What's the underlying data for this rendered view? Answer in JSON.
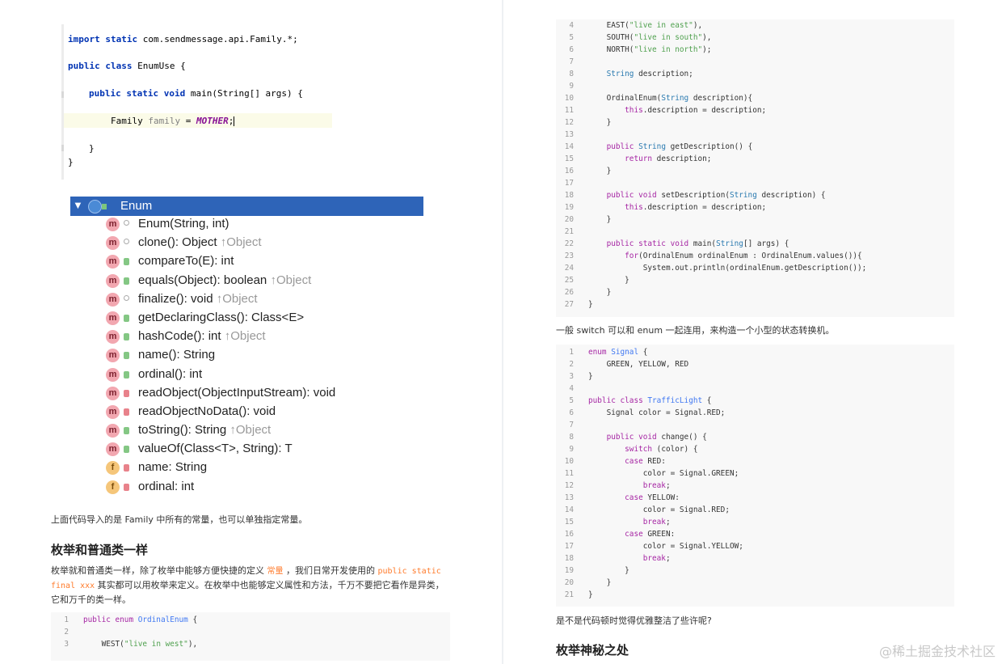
{
  "ide": {
    "lines": [
      {
        "segments": [
          [
            "kw",
            "import static "
          ],
          [
            "plain",
            "com.sendmessage.api.Family.*;"
          ]
        ]
      },
      {
        "segments": [
          [
            "kw",
            "public class "
          ],
          [
            "plain",
            "EnumUse {"
          ]
        ]
      },
      {
        "segments": [
          [
            "kw",
            "public static void "
          ],
          [
            "plain",
            "main(String[] args) {"
          ]
        ]
      },
      {
        "segments": [
          [
            "plain",
            "Family "
          ],
          [
            "grey",
            "family"
          ],
          [
            "plain",
            " = "
          ],
          [
            "const",
            "MOTHER"
          ],
          [
            "plain",
            ";"
          ]
        ]
      },
      {
        "segments": [
          [
            "plain",
            "}"
          ]
        ]
      },
      {
        "segments": [
          [
            "plain",
            "}"
          ]
        ]
      }
    ]
  },
  "tree": {
    "root": "Enum",
    "members": [
      {
        "kind": "m",
        "access": "key",
        "sig": "Enum(String, int)",
        "inherited": ""
      },
      {
        "kind": "m",
        "access": "key",
        "sig": "clone(): Object",
        "inherited": "↑Object"
      },
      {
        "kind": "m",
        "access": "pub",
        "sig": "compareTo(E): int",
        "inherited": ""
      },
      {
        "kind": "m",
        "access": "pub",
        "sig": "equals(Object): boolean",
        "inherited": "↑Object"
      },
      {
        "kind": "m",
        "access": "key",
        "sig": "finalize(): void",
        "inherited": "↑Object"
      },
      {
        "kind": "m",
        "access": "pub",
        "sig": "getDeclaringClass(): Class<E>",
        "inherited": ""
      },
      {
        "kind": "m",
        "access": "pub",
        "sig": "hashCode(): int",
        "inherited": "↑Object"
      },
      {
        "kind": "m",
        "access": "pub",
        "sig": "name(): String",
        "inherited": ""
      },
      {
        "kind": "m",
        "access": "pub",
        "sig": "ordinal(): int",
        "inherited": ""
      },
      {
        "kind": "m",
        "access": "priv",
        "sig": "readObject(ObjectInputStream): void",
        "inherited": ""
      },
      {
        "kind": "m",
        "access": "priv",
        "sig": "readObjectNoData(): void",
        "inherited": ""
      },
      {
        "kind": "m",
        "access": "pub",
        "sig": "toString(): String",
        "inherited": "↑Object"
      },
      {
        "kind": "m",
        "access": "pub",
        "sig": "valueOf(Class<T>, String): T",
        "inherited": ""
      },
      {
        "kind": "f",
        "access": "priv",
        "sig": "name: String",
        "inherited": ""
      },
      {
        "kind": "f",
        "access": "priv",
        "sig": "ordinal: int",
        "inherited": ""
      }
    ]
  },
  "text": {
    "p1": "上面代码导入的是 Family 中所有的常量，也可以单独指定常量。",
    "h_enum_like_class": "枚举和普通类一样",
    "p2_a": "枚举就和普通类一样，除了枚举中能够方便快捷的定义 ",
    "p2_code1": "常量",
    "p2_b": " ，我们日常开发使用的 ",
    "p2_code2": "public static",
    "p2_code3": "final xxx",
    "p2_c": " 其实都可以用枚举来定义。在枚举中也能够定义属性和方法，千万不要把它看作是异类，",
    "p2_d": "它和万千的类一样。",
    "p3": "一般 switch 可以和 enum 一起连用，来构造一个小型的状态转换机。",
    "p4": "是不是代码顿时觉得优雅整洁了些许呢?",
    "h_secret": "枚举神秘之处",
    "watermark": "@稀土掘金技术社区"
  },
  "code_left": [
    [
      "1",
      "<k>public enum </k><t>OrdinalEnum</t> {"
    ],
    [
      "2",
      ""
    ],
    [
      "3",
      "    WEST(<s>\"live in west\"</s>),"
    ]
  ],
  "code_right_top": [
    [
      "4",
      "    EAST(<s>\"live in east\"</s>),"
    ],
    [
      "5",
      "    SOUTH(<s>\"live in south\"</s>),"
    ],
    [
      "6",
      "    NORTH(<s>\"live in north\"</s>);"
    ],
    [
      "7",
      ""
    ],
    [
      "8",
      "    <b>String</b> description;"
    ],
    [
      "9",
      ""
    ],
    [
      "10",
      "    OrdinalEnum(<b>String</b> description){"
    ],
    [
      "11",
      "        <k>this</k>.description = description;"
    ],
    [
      "12",
      "    }"
    ],
    [
      "13",
      ""
    ],
    [
      "14",
      "    <k>public</k> <b>String</b> getDescription() {"
    ],
    [
      "15",
      "        <k>return</k> description;"
    ],
    [
      "16",
      "    }"
    ],
    [
      "17",
      ""
    ],
    [
      "18",
      "    <k>public void</k> setDescription(<b>String</b> description) {"
    ],
    [
      "19",
      "        <k>this</k>.description = description;"
    ],
    [
      "20",
      "    }"
    ],
    [
      "21",
      ""
    ],
    [
      "22",
      "    <k>public static void</k> main(<b>String</b>[] args) {"
    ],
    [
      "23",
      "        <k>for</k>(OrdinalEnum ordinalEnum : OrdinalEnum.values()){"
    ],
    [
      "24",
      "            System.out.println(ordinalEnum.getDescription());"
    ],
    [
      "25",
      "        }"
    ],
    [
      "26",
      "    }"
    ],
    [
      "27",
      "}"
    ]
  ],
  "code_right_bottom": [
    [
      "1",
      "<k>enum</k> <t>Signal</t> {"
    ],
    [
      "2",
      "    GREEN, YELLOW, RED"
    ],
    [
      "3",
      "}"
    ],
    [
      "4",
      ""
    ],
    [
      "5",
      "<k>public class</k> <t>TrafficLight</t> {"
    ],
    [
      "6",
      "    Signal color = Signal.RED;"
    ],
    [
      "7",
      ""
    ],
    [
      "8",
      "    <k>public void</k> change() {"
    ],
    [
      "9",
      "        <k>switch</k> (color) {"
    ],
    [
      "10",
      "        <k>case</k> RED:"
    ],
    [
      "11",
      "            color = Signal.GREEN;"
    ],
    [
      "12",
      "            <k>break</k>;"
    ],
    [
      "13",
      "        <k>case</k> YELLOW:"
    ],
    [
      "14",
      "            color = Signal.RED;"
    ],
    [
      "15",
      "            <k>break</k>;"
    ],
    [
      "16",
      "        <k>case</k> GREEN:"
    ],
    [
      "17",
      "            color = Signal.YELLOW;"
    ],
    [
      "18",
      "            <k>break</k>;"
    ],
    [
      "19",
      "        }"
    ],
    [
      "20",
      "    }"
    ],
    [
      "21",
      "}"
    ]
  ]
}
